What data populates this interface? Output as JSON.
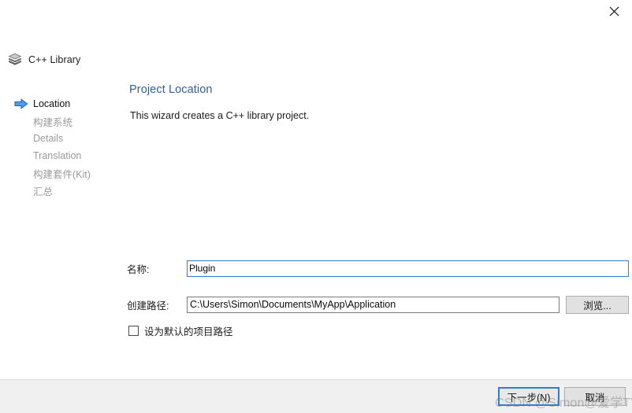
{
  "window": {
    "close_icon": "close-icon"
  },
  "header": {
    "icon": "library-stack-icon",
    "title": "C++ Library"
  },
  "sidebar": {
    "active_arrow_icon": "blue-right-arrow-icon",
    "steps": [
      {
        "label": "Location",
        "active": true
      },
      {
        "label": "构建系统",
        "active": false
      },
      {
        "label": "Details",
        "active": false
      },
      {
        "label": "Translation",
        "active": false
      },
      {
        "label": "构建套件(Kit)",
        "active": false
      },
      {
        "label": "汇总",
        "active": false
      }
    ]
  },
  "content": {
    "title": "Project Location",
    "subtitle": "This wizard creates a C++ library project."
  },
  "form": {
    "name": {
      "label": "名称:",
      "value": "Plugin",
      "placeholder": ""
    },
    "path": {
      "label": "创建路径:",
      "value": "C:\\Users\\Simon\\Documents\\MyApp\\Application",
      "placeholder": "",
      "browse_label": "浏览..."
    },
    "default_path_checkbox": {
      "label": "设为默认的项目路径",
      "checked": false
    }
  },
  "footer": {
    "next_label": "下一步(N)",
    "cancel_label": "取消"
  },
  "watermark": {
    "text": "CSDN @Simon@爱学TV"
  },
  "colors": {
    "accent": "#2b5f9e",
    "selection": "#0a7bd4",
    "focus_border": "#2a7fd4",
    "inactive_step": "#9a9a9a",
    "footer_bg": "#f0f0f0"
  }
}
